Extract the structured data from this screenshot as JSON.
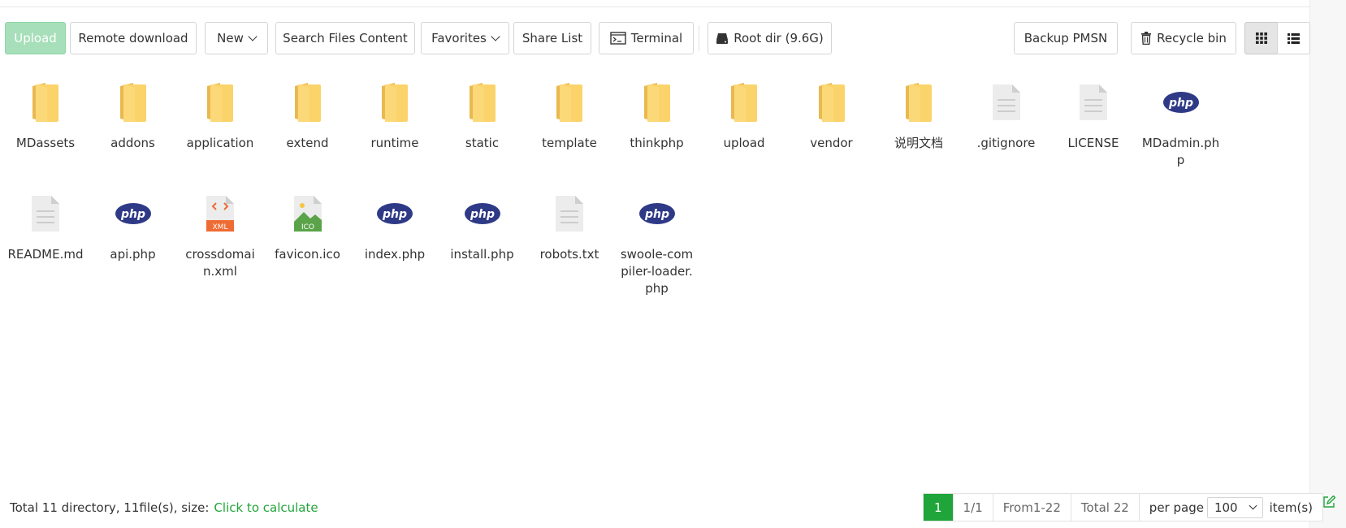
{
  "toolbar": {
    "upload": "Upload",
    "remote_download": "Remote download",
    "new": "New",
    "search_files_content": "Search Files Content",
    "favorites": "Favorites",
    "share_list": "Share List",
    "terminal": "Terminal",
    "root_dir": "Root dir (9.6G)",
    "backup": "Backup PMSN",
    "recycle_bin": "Recycle bin",
    "view_grid_icon": "grid-icon",
    "view_list_icon": "list-icon"
  },
  "files": [
    {
      "name": "MDassets",
      "type": "folder"
    },
    {
      "name": "addons",
      "type": "folder"
    },
    {
      "name": "application",
      "type": "folder"
    },
    {
      "name": "extend",
      "type": "folder"
    },
    {
      "name": "runtime",
      "type": "folder"
    },
    {
      "name": "static",
      "type": "folder"
    },
    {
      "name": "template",
      "type": "folder"
    },
    {
      "name": "thinkphp",
      "type": "folder"
    },
    {
      "name": "upload",
      "type": "folder"
    },
    {
      "name": "vendor",
      "type": "folder"
    },
    {
      "name": "说明文档",
      "type": "folder"
    },
    {
      "name": ".gitignore",
      "type": "text"
    },
    {
      "name": "LICENSE",
      "type": "text"
    },
    {
      "name": "MDadmin.php",
      "type": "php"
    },
    {
      "name": "README.md",
      "type": "text"
    },
    {
      "name": "api.php",
      "type": "php"
    },
    {
      "name": "crossdomain.xml",
      "type": "xml"
    },
    {
      "name": "favicon.ico",
      "type": "image"
    },
    {
      "name": "index.php",
      "type": "php"
    },
    {
      "name": "install.php",
      "type": "php"
    },
    {
      "name": "robots.txt",
      "type": "text"
    },
    {
      "name": "swoole-compiler-loader.php",
      "type": "php"
    }
  ],
  "icon_text": {
    "php": "php",
    "xml": "XML",
    "ico": "ICO"
  },
  "footer": {
    "summary": "Total 11 directory, 11file(s), size:",
    "calculate": "Click to calculate",
    "page": "1",
    "pages": "1/1",
    "range": "From1-22",
    "total": "Total 22",
    "per_page_label": "per page",
    "per_page_value": "100",
    "items_label": "item(s)"
  },
  "colors": {
    "accent": "#20a53a",
    "upload_bg": "#a6dfb9",
    "folder": "#fbd36b",
    "php": "#2f3a87",
    "xml": "#ee6b33",
    "ico": "#5aa349"
  }
}
